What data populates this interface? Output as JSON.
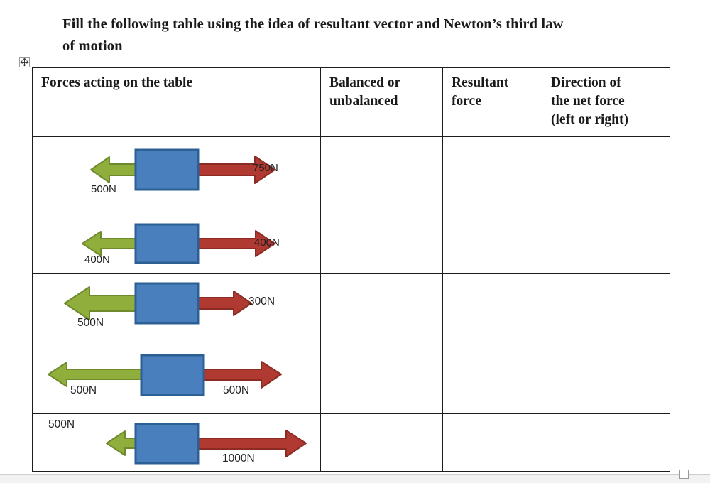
{
  "document": {
    "title_lines": [
      "Fill the following table using the idea of resultant vector and Newton’s third law",
      "of motion"
    ],
    "title_text": "Fill the following table using the idea of resultant vector and Newton’s third law of motion"
  },
  "colors": {
    "box_fill": "#4a7fbd",
    "box_stroke": "#2c5f94",
    "arrow_left_fill": "#8fae3c",
    "arrow_left_stroke": "#6f8a2c",
    "arrow_right_fill": "#b03a32",
    "arrow_right_stroke": "#8c2b24",
    "table_border": "#1c1c1c",
    "text": "#1a1a1a"
  },
  "table": {
    "headers": [
      "Forces acting on the table",
      "Balanced or unbalanced",
      "Resultant force",
      "Direction of the net force (left or right)"
    ],
    "header_lines": [
      [
        "Forces acting on the table"
      ],
      [
        "Balanced or",
        "unbalanced"
      ],
      [
        "Resultant",
        "force"
      ],
      [
        "Direction of",
        "the net force",
        "(left or right)"
      ]
    ],
    "rows": [
      {
        "row_index": 1,
        "left_force": "500N",
        "right_force": "750N",
        "left_label": "500N",
        "right_label": "750N",
        "balanced": "",
        "resultant": "",
        "direction": ""
      },
      {
        "row_index": 2,
        "left_force": "400N",
        "right_force": "400N",
        "left_label": "400N",
        "right_label": "400N",
        "balanced": "",
        "resultant": "",
        "direction": ""
      },
      {
        "row_index": 3,
        "left_force": "500N",
        "right_force": "300N",
        "left_label": "500N",
        "right_label": "300N",
        "balanced": "",
        "resultant": "",
        "direction": ""
      },
      {
        "row_index": 4,
        "left_force": "500N",
        "right_force": "500N",
        "left_label": "500N",
        "right_label": "500N",
        "balanced": "",
        "resultant": "",
        "direction": ""
      },
      {
        "row_index": 5,
        "left_force": "500N",
        "right_force": "1000N",
        "left_label": "500N",
        "right_label": "1000N",
        "balanced": "",
        "resultant": "",
        "direction": ""
      }
    ]
  },
  "icons": {
    "table_move_handle": "move-four-arrows-icon",
    "resize_handle": "resize-grip-icon"
  }
}
